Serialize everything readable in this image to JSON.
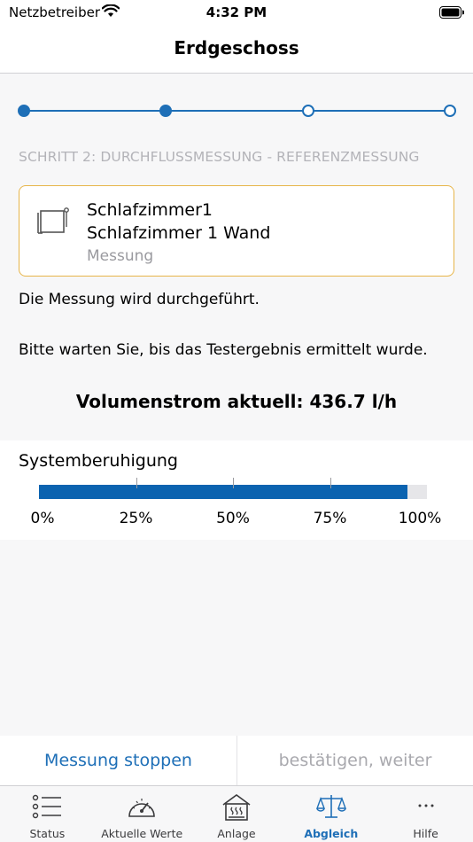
{
  "status_bar": {
    "carrier": "Netzbetreiber",
    "time": "4:32 PM"
  },
  "nav": {
    "title": "Erdgeschoss"
  },
  "stepper": {
    "total_steps": 4,
    "completed_steps": 2,
    "caption": "SCHRITT 2: DURCHFLUSSMESSUNG - REFERENZMESSUNG"
  },
  "room_card": {
    "name": "Schlafzimmer1",
    "wall": "Schlafzimmer 1 Wand",
    "type": "Messung",
    "icon": "window-icon"
  },
  "messages": {
    "running": "Die Messung wird durchgeführt.",
    "wait": "Bitte warten Sie, bis das Testergebnis ermittelt wurde."
  },
  "flow": {
    "text": "Volumenstrom aktuell: 436.7 l/h"
  },
  "progress": {
    "title": "Systemberuhigung",
    "percent": 95,
    "ticks": [
      "0%",
      "25%",
      "50%",
      "75%",
      "100%"
    ]
  },
  "actions": {
    "stop_label": "Messung stoppen",
    "confirm_label": "bestätigen, weiter"
  },
  "tabs": [
    {
      "label": "Status",
      "icon": "list-icon"
    },
    {
      "label": "Aktuelle Werte",
      "icon": "gauge-icon"
    },
    {
      "label": "Anlage",
      "icon": "heating-icon"
    },
    {
      "label": "Abgleich",
      "icon": "scale-icon",
      "active": true
    },
    {
      "label": "Hilfe",
      "icon": "more-icon"
    }
  ],
  "colors": {
    "accent": "#1e6fb7",
    "progress_fill": "#0b63b0",
    "card_border": "#e7b54a",
    "muted_text": "#a9a9ae"
  }
}
